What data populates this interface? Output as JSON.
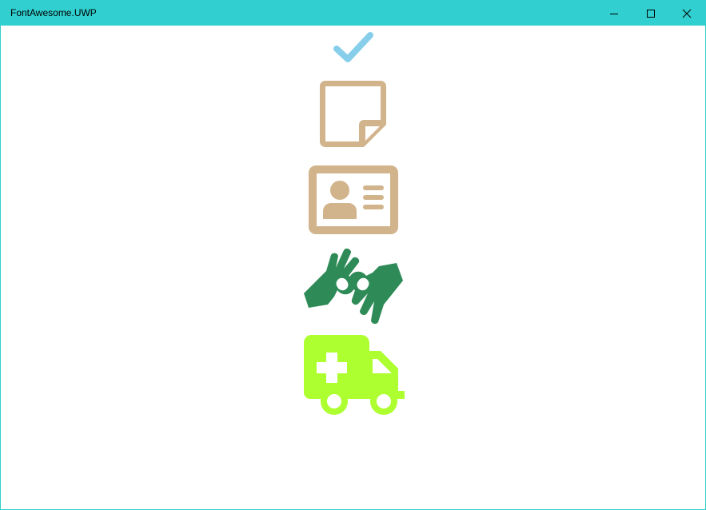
{
  "window": {
    "title": "FontAwesome.UWP",
    "accent_color": "#31cfcf"
  },
  "caption_buttons": {
    "minimize": "minimize-icon",
    "maximize": "maximize-icon",
    "close": "close-icon"
  },
  "icons": [
    {
      "name": "check-icon",
      "color": "#87ceeb"
    },
    {
      "name": "sticky-note-icon",
      "color": "#d2b48c"
    },
    {
      "name": "id-card-icon",
      "color": "#d2b48c"
    },
    {
      "name": "sign-language-interpreting-icon",
      "color": "#2e8b57"
    },
    {
      "name": "ambulance-icon",
      "color": "#adff2f"
    }
  ]
}
